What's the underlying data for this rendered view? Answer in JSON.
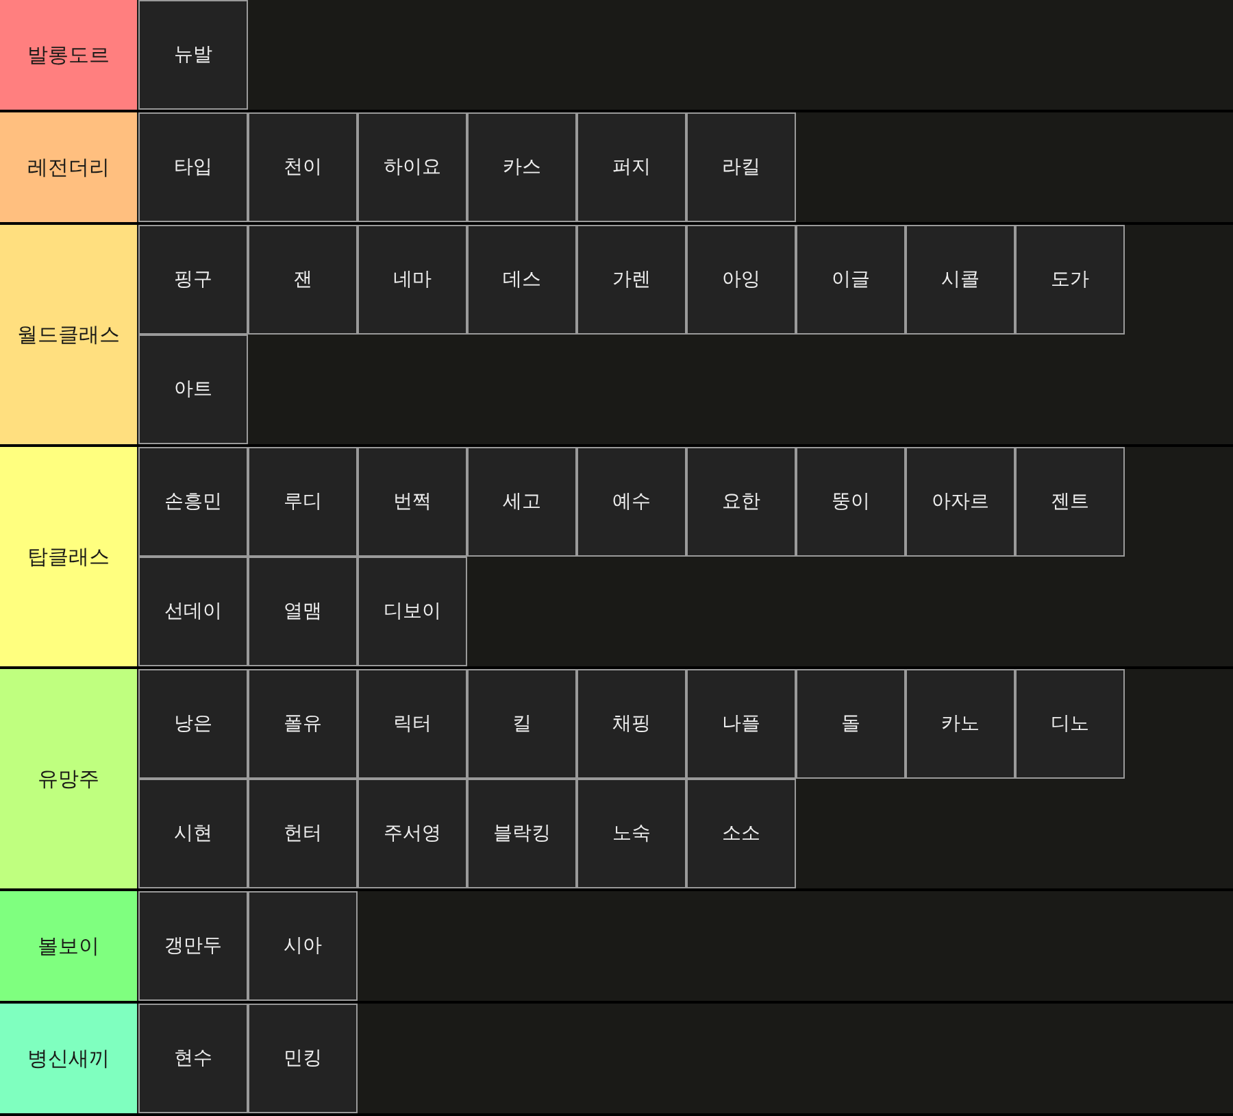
{
  "tiers": [
    {
      "label": "발롱도르",
      "color": "#ff7f7f",
      "items": [
        "뉴발"
      ]
    },
    {
      "label": "레전더리",
      "color": "#ffbf7f",
      "items": [
        "타입",
        "천이",
        "하이요",
        "카스",
        "퍼지",
        "라킬"
      ]
    },
    {
      "label": "월드클래스",
      "color": "#ffdf7f",
      "items": [
        "핑구",
        "잰",
        "네마",
        "데스",
        "가렌",
        "아잉",
        "이글",
        "시콜",
        "도가",
        "아트"
      ]
    },
    {
      "label": "탑클래스",
      "color": "#ffff7f",
      "items": [
        "손흥민",
        "루디",
        "번쩍",
        "세고",
        "예수",
        "요한",
        "뚱이",
        "아자르",
        "젠트",
        "선데이",
        "열맴",
        "디보이"
      ]
    },
    {
      "label": "유망주",
      "color": "#bfff7f",
      "items": [
        "낭은",
        "폴유",
        "릭터",
        "킬",
        "채핑",
        "나플",
        "돌",
        "카노",
        "디노",
        "시현",
        "헌터",
        "주서영",
        "블락킹",
        "노숙",
        "소소"
      ]
    },
    {
      "label": "볼보이",
      "color": "#7fff7f",
      "items": [
        "갱만두",
        "시아"
      ]
    },
    {
      "label": "병신새끼",
      "color": "#7fffbf",
      "items": [
        "현수",
        "민킹"
      ]
    }
  ]
}
